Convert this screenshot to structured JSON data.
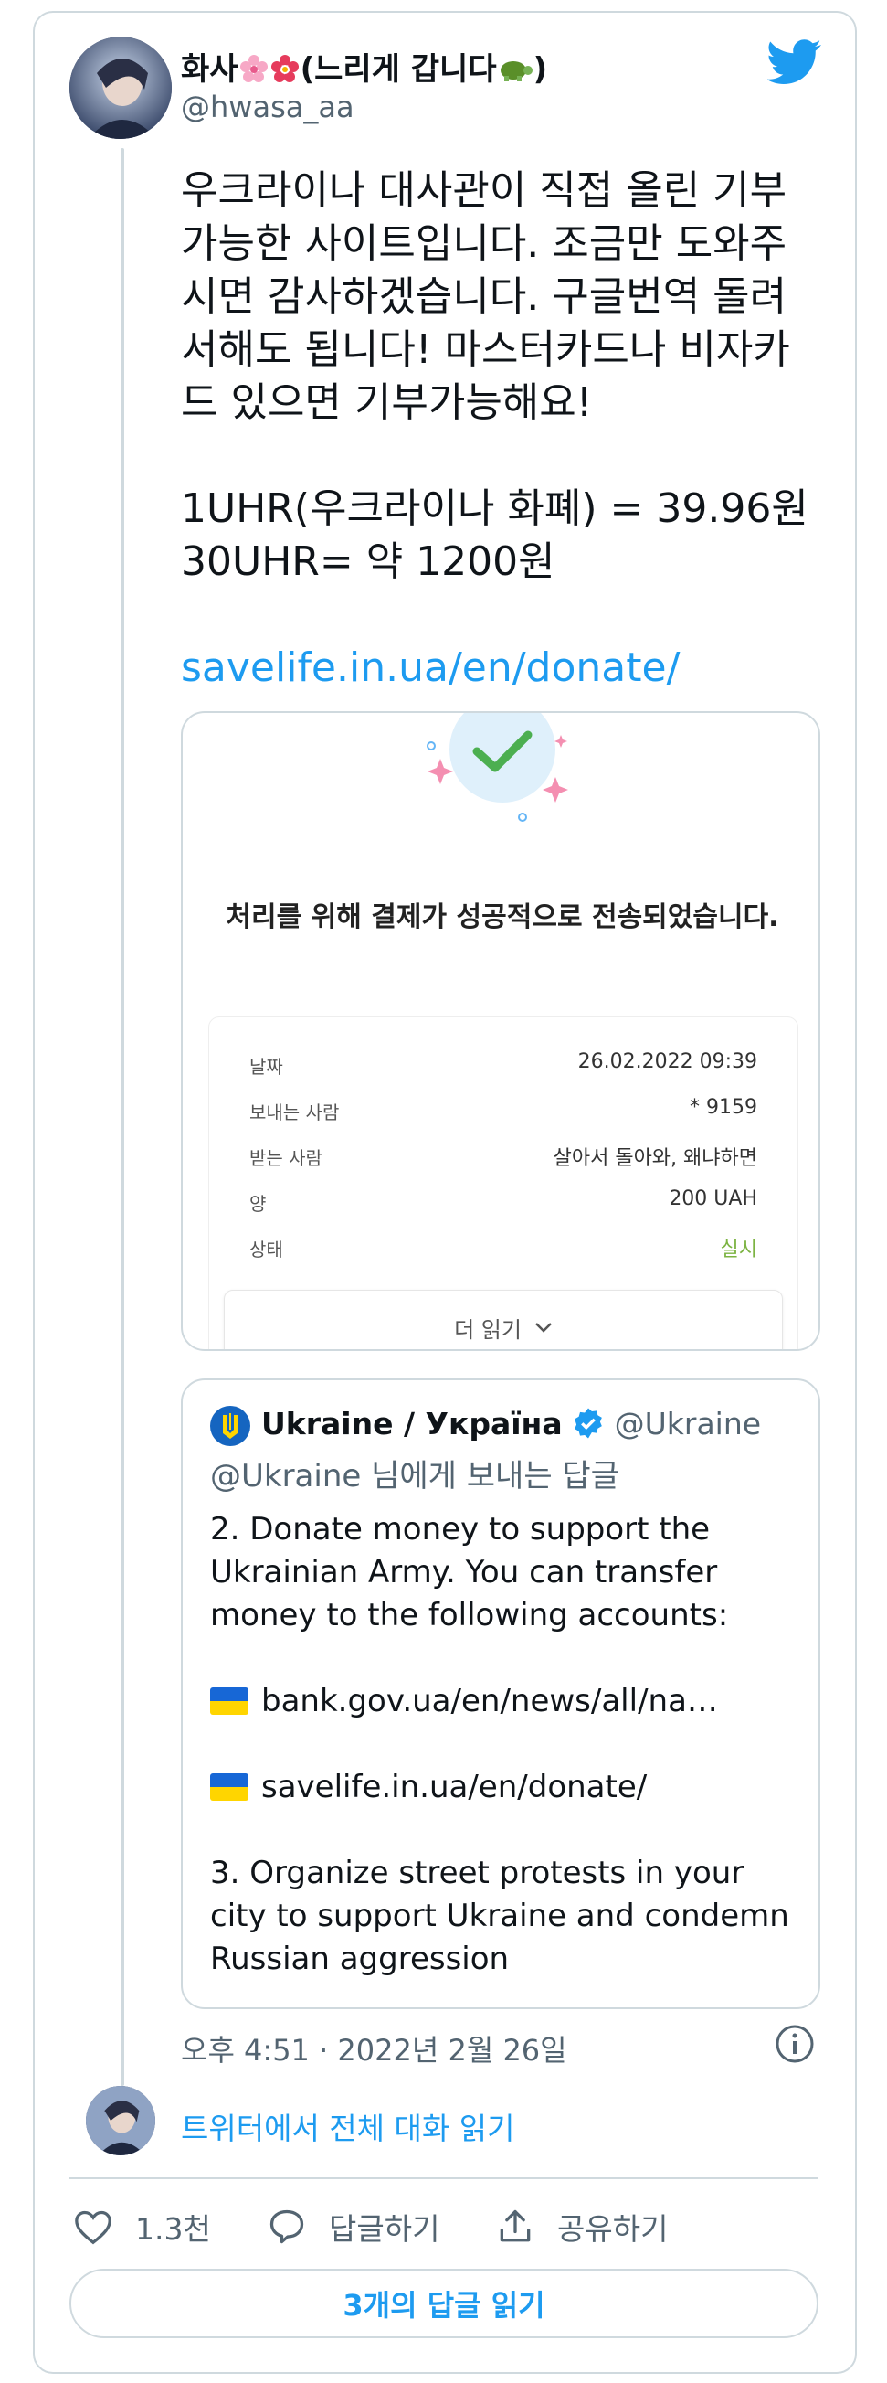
{
  "author": {
    "name": "화사",
    "name_suffix": "(느리게 갑니다",
    "name_end": ")",
    "handle": "@hwasa_aa"
  },
  "tweet": {
    "text_paragraph1": "우크라이나 대사관이 직접 올린 기부 가능한 사이트입니다. 조금만 도와주시면 감사하겠습니다. 구글번역 돌려서해도 됩니다! 마스터카드나 비자카드 있으면 기부가능해요!",
    "rate_line1": "1UHR(우크라이나 화폐) = 39.96원",
    "rate_line2": "30UHR= 약 1200원",
    "link": "savelife.in.ua/en/donate/"
  },
  "preview": {
    "success_message": "처리를 위해 결제가 성공적으로 전송되었습니다.",
    "rows": [
      {
        "label": "날짜",
        "value": "26.02.2022 09:39"
      },
      {
        "label": "보내는 사람",
        "value": "* 9159"
      },
      {
        "label": "받는 사람",
        "value": "살아서 돌아와, 왜냐하면"
      },
      {
        "label": "양",
        "value": "200  UAH"
      },
      {
        "label": "상태",
        "value": "실시"
      }
    ],
    "read_more": "더 읽기"
  },
  "quote": {
    "name": "Ukraine / Україна",
    "handle": "@Ukraine",
    "reply_to": "@Ukraine 님에게 보내는 답글",
    "para1": "2. Donate money to support the Ukrainian Army. You can transfer money to the following accounts:",
    "link1": "bank.gov.ua/en/news/all/na…",
    "link2": "savelife.in.ua/en/donate/",
    "para3": "3. Organize street protests in your city to support Ukraine and condemn Russian aggression"
  },
  "meta": {
    "timestamp": "오후 4:51 · 2022년 2월 26일"
  },
  "read_conversation": "트위터에서 전체 대화 읽기",
  "actions": {
    "like_count": "1.3천",
    "reply_label": "답글하기",
    "share_label": "공유하기"
  },
  "replies_button": "3개의 답글 읽기",
  "colors": {
    "accent": "#1d9bf0",
    "status_green": "#7cb342",
    "border": "#cfd9de",
    "secondary_text": "#536471"
  },
  "icons": [
    "twitter-bird-icon",
    "cherry-blossom-icon",
    "flower-icon",
    "turtle-icon",
    "verified-badge-icon",
    "ukraine-emblem-icon",
    "ukraine-flag-icon",
    "info-icon",
    "heart-icon",
    "reply-icon",
    "share-icon",
    "checkmark-icon",
    "chevron-down-icon"
  ]
}
